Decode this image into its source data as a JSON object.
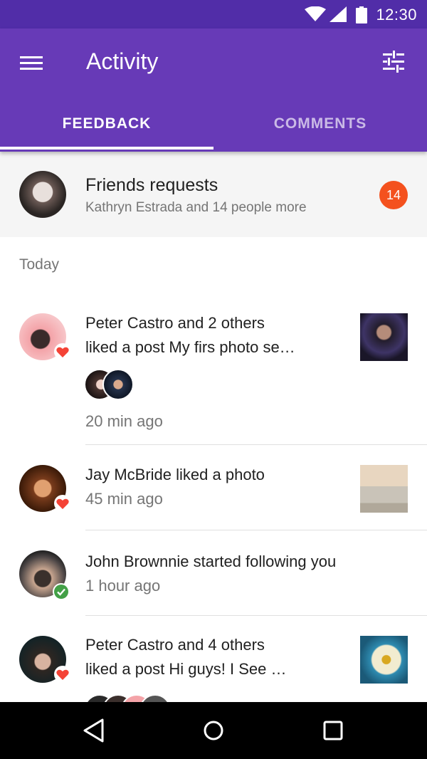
{
  "status_bar": {
    "time": "12:30"
  },
  "app_bar": {
    "title": "Activity"
  },
  "tabs": [
    {
      "label": "FEEDBACK",
      "active": true
    },
    {
      "label": "COMMENTS",
      "active": false
    }
  ],
  "friend_requests": {
    "title": "Friends requests",
    "subtitle": "Kathryn Estrada and 14 people more",
    "count": "14"
  },
  "section_header": "Today",
  "notifications": [
    {
      "name": "Peter Castro",
      "rest": " and 2 others",
      "line2": "liked a post My firs photo se…",
      "time": "20 min ago",
      "badge": "heart-icon"
    },
    {
      "name": "Jay McBride",
      "rest": " liked a photo",
      "time": "45 min ago",
      "badge": "heart-icon"
    },
    {
      "name": "John Brownnie",
      "rest": " started following you",
      "time": "1 hour ago",
      "badge": "check-icon"
    },
    {
      "name": "Peter Castro",
      "rest": " and 4 others",
      "line2": "liked a post Hi guys! I See …",
      "badge": "heart-icon"
    }
  ],
  "colors": {
    "primary": "#673ab7",
    "primary_dark": "#512da8",
    "badge": "#f4511e",
    "heart": "#f44336",
    "check": "#43a047"
  }
}
